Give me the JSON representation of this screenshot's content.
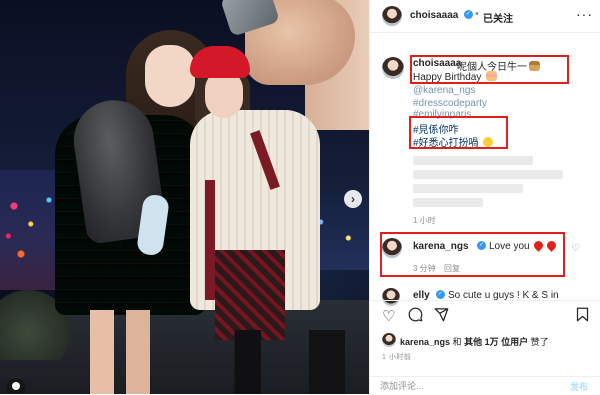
{
  "header": {
    "username": "choisaaaa",
    "dot": "•",
    "follow_status": "已关注",
    "more": "···"
  },
  "caption": {
    "username": "choisaaaa",
    "text": "呢個人今日牛一",
    "line2": "Happy Birthday",
    "mention": "@karena_ngs",
    "hashtags": [
      "#dresscodeparty",
      "#emilyinparis",
      "#見係你咋",
      "#好悉心打扮喎"
    ],
    "time": "1 小时"
  },
  "comments": [
    {
      "username": "karena_ngs",
      "text": "Love you",
      "time": "3 分钟",
      "reply": "回复"
    },
    {
      "username": "elly",
      "text": "So cute u guys ! K & S in"
    }
  ],
  "likes": {
    "username": "karena_ngs",
    "middle": "和",
    "others": "其他 1万 位用户",
    "end": "赞了",
    "time": "1 小时前"
  },
  "composer": {
    "placeholder": "添加评论...",
    "post_label": "发布"
  },
  "colors": {
    "verified": "#3897f0",
    "highlight_box": "#e0201a",
    "link": "#00376b"
  }
}
